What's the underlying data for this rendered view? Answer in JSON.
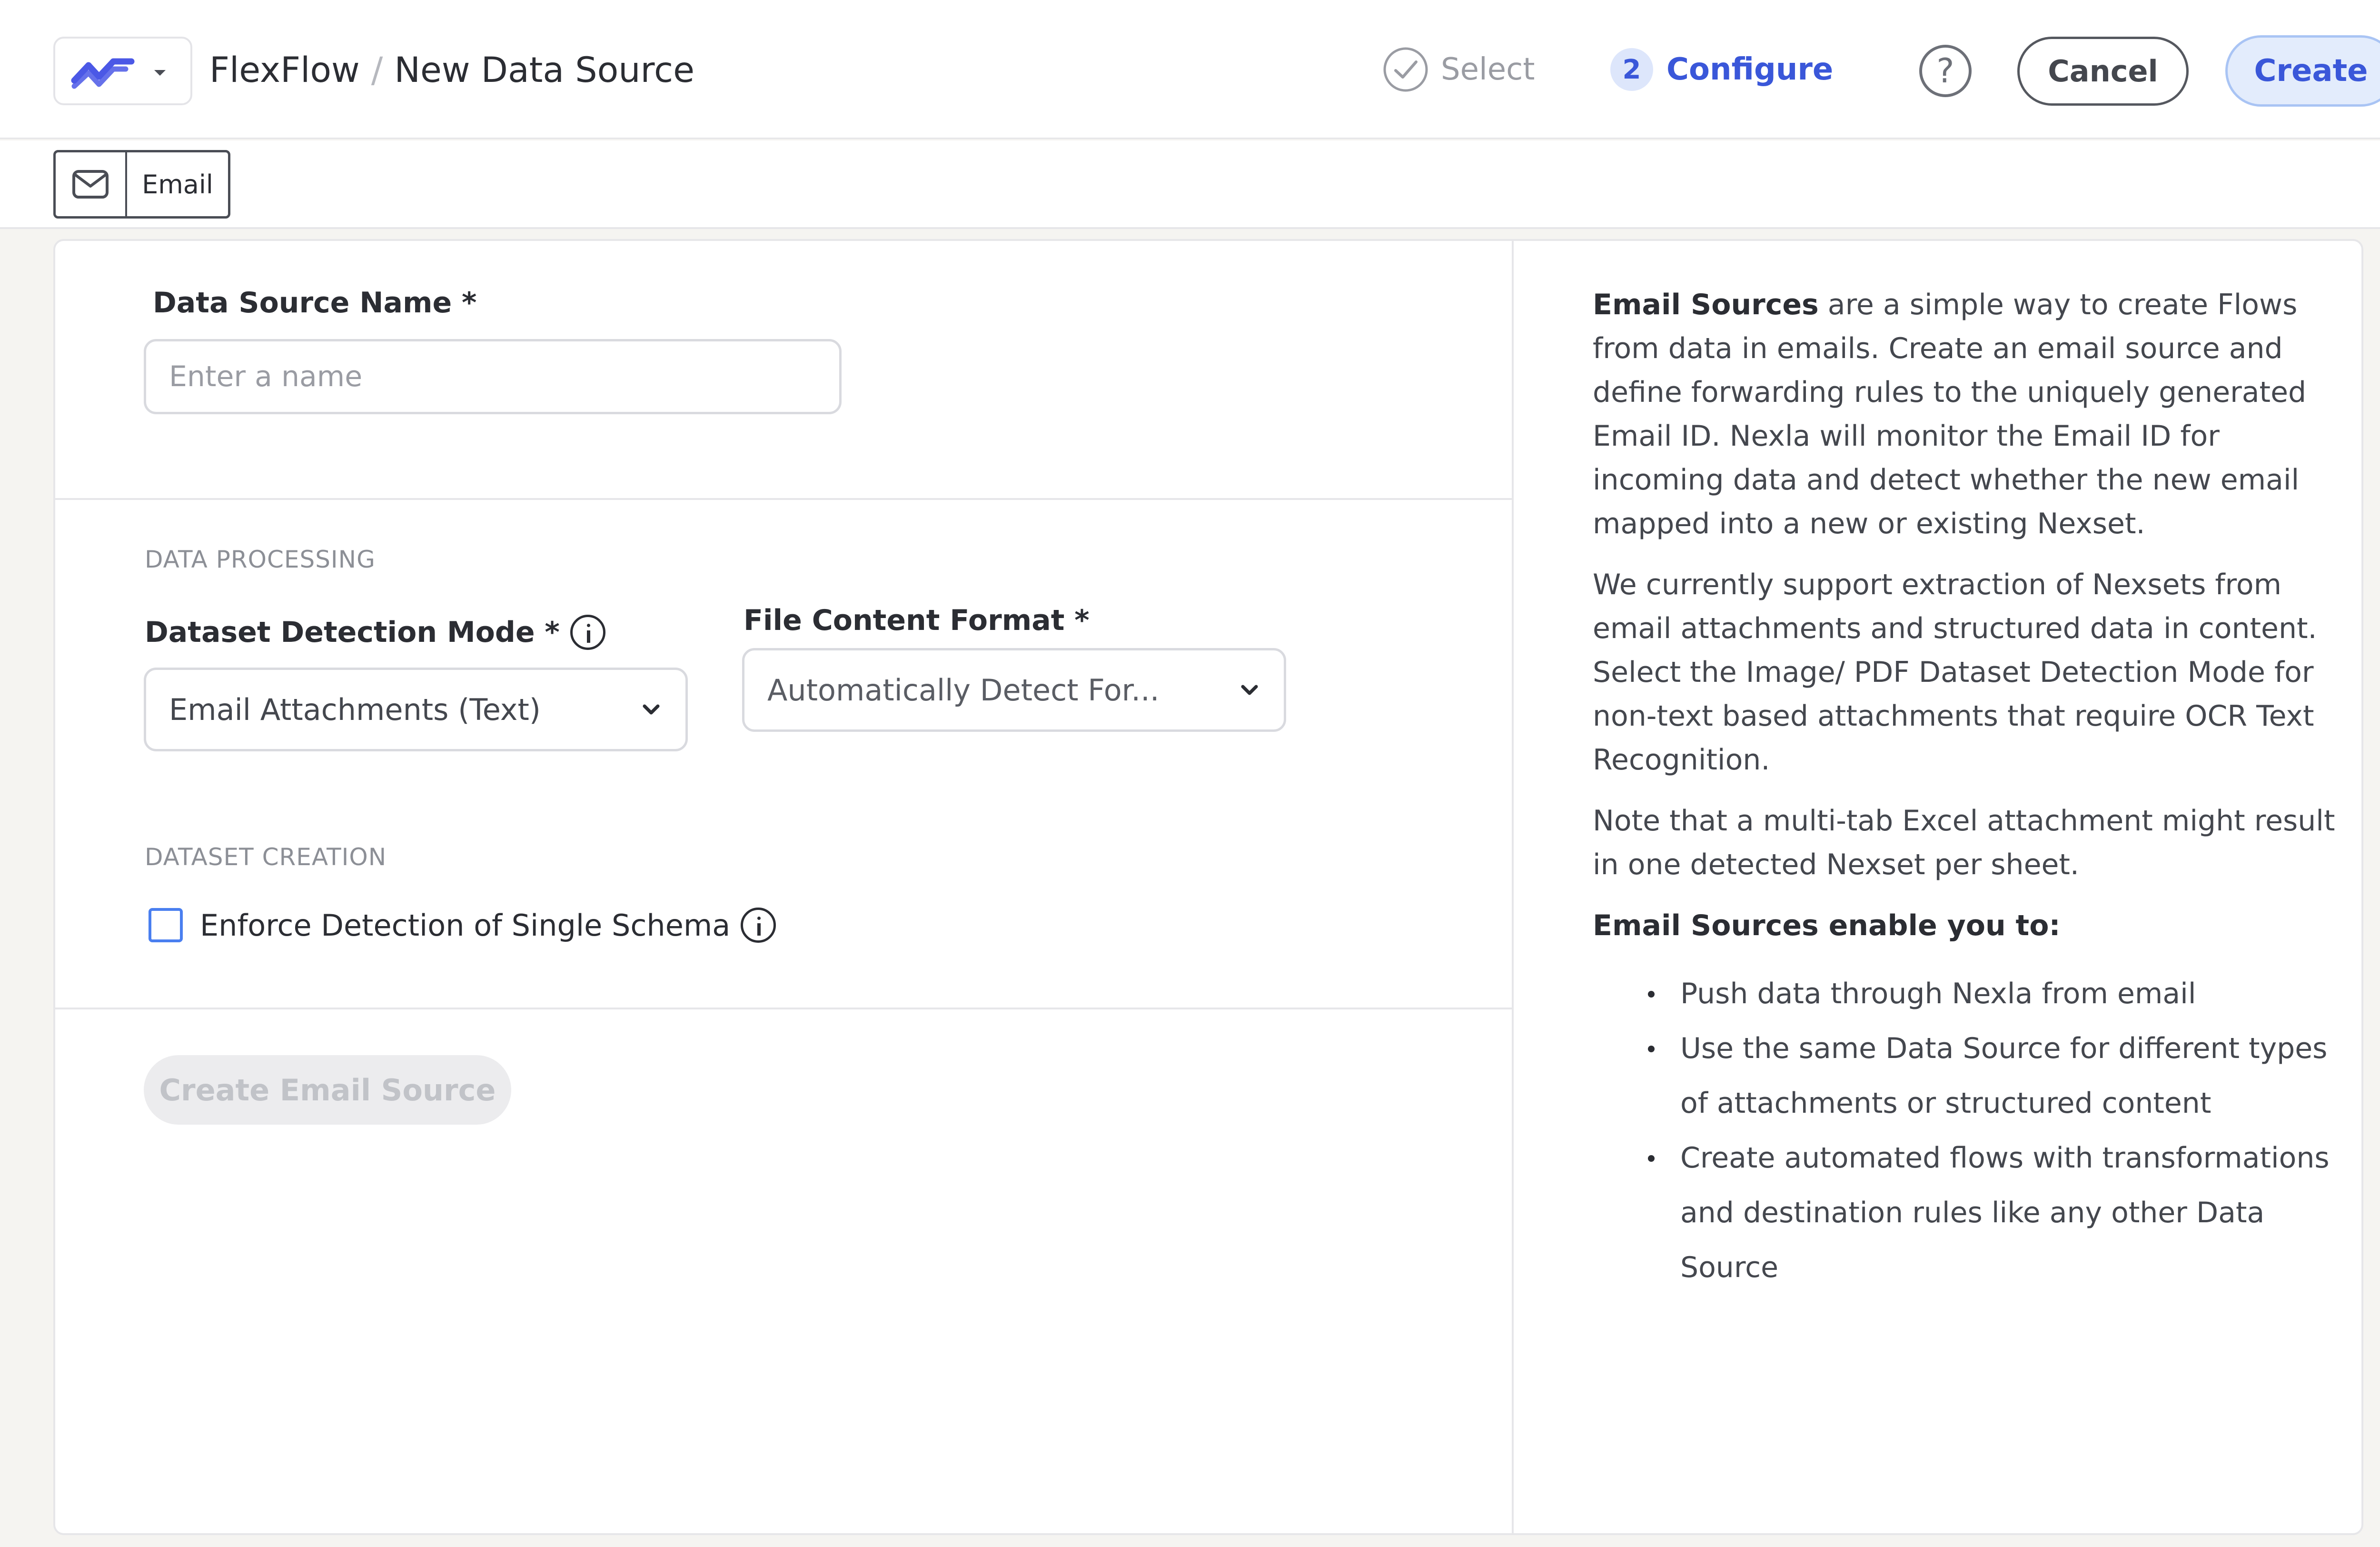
{
  "header": {
    "app_name": "FlexFlow",
    "separator": "/",
    "page_name": "New Data Source",
    "steps": [
      {
        "label": "Select",
        "state": "done"
      },
      {
        "number": "2",
        "label": "Configure",
        "state": "active"
      }
    ],
    "help_label": "?",
    "cancel_label": "Cancel",
    "create_label": "Create",
    "brand_color": "#3a57d9"
  },
  "source_chip": {
    "icon": "mail-icon",
    "label": "Email"
  },
  "form": {
    "name_label": "Data Source Name *",
    "name_value": "",
    "name_placeholder": "Enter a name",
    "processing_header": "DATA PROCESSING",
    "detection_mode_label": "Dataset Detection Mode *",
    "detection_mode_value": "Email Attachments (Text)",
    "file_format_label": "File Content Format *",
    "file_format_value": "Automatically Detect For...",
    "creation_header": "DATASET CREATION",
    "enforce_schema_label": "Enforce Detection of Single Schema",
    "enforce_schema_checked": false,
    "submit_label": "Create Email Source",
    "submit_disabled": true
  },
  "help_panel": {
    "p1_bold": "Email Sources",
    "p1_rest": " are a simple way to create Flows from data in emails. Create an email source and define forwarding rules to the uniquely generated Email ID. Nexla will monitor the Email ID for incoming data and detect whether the new email mapped into a new or existing Nexset.",
    "p2": "We currently support extraction of Nexsets from email attachments and structured data in content. Select the Image/ PDF Dataset Detection Mode for non-text based attachments that require OCR Text Recognition.",
    "p3": "Note that a multi-tab Excel attachment might result in one detected Nexset per sheet.",
    "subhead": "Email Sources enable you to:",
    "bullets": [
      "Push data through Nexla from email",
      "Use the same Data Source for different types of attachments or structured content",
      "Create automated flows with transformations and destination rules like any other Data Source"
    ]
  }
}
